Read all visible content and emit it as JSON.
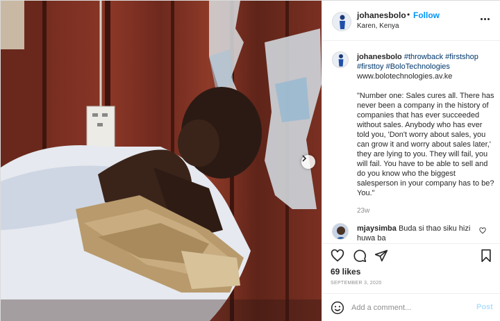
{
  "post": {
    "username": "johanesbolo",
    "separator": "•",
    "follow_label": "Follow",
    "location": "Karen, Kenya",
    "more_icon": "more-options-icon"
  },
  "caption": {
    "username": "johanesbolo",
    "hashtags": [
      "#throwback",
      "#firstshop",
      "#firsttoy",
      "#BoloTechnologies"
    ],
    "link": "www.bolotechnologies.av.ke",
    "quote": "\"Number one: Sales cures all. There has never been a company in the history of companies that has ever succeeded without sales. Anybody who has ever told you, 'Don't worry about sales, you can grow it and worry about sales later,' they are lying to you. They will fail, you will fail. You have to be able to sell and do you know who the biggest salesperson in your company has to be? You.\"",
    "time": "23w"
  },
  "comment": {
    "username": "mjaysimba",
    "text": "Buda si thao siku hizi huwa ba"
  },
  "actions": {
    "like_icon": "heart-icon",
    "comment_icon": "comment-icon",
    "share_icon": "paper-plane-icon",
    "save_icon": "bookmark-icon"
  },
  "likes": "69 likes",
  "date": "SEPTEMBER 3, 2020",
  "add_comment": {
    "placeholder": "Add a comment...",
    "post_label": "Post"
  },
  "colors": {
    "accent": "#0095f6",
    "post_disabled": "#b2dffc",
    "secondary_text": "#8e8e8e",
    "hashtag": "#00376b"
  }
}
